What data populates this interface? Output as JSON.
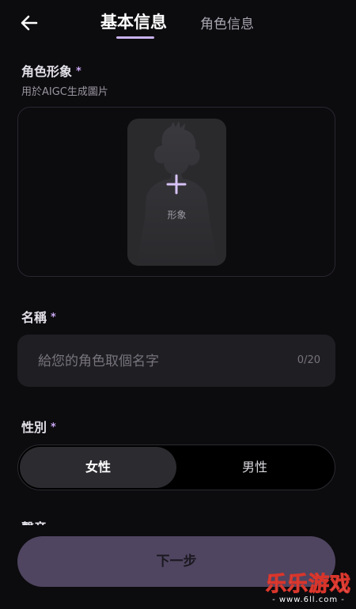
{
  "header": {
    "back_icon": "arrow-left-icon",
    "tabs": [
      {
        "label": "基本信息",
        "active": true
      },
      {
        "label": "角色信息",
        "active": false
      }
    ],
    "accent_color": "#c9b2ee"
  },
  "avatar_section": {
    "label": "角色形象",
    "required_mark": "*",
    "subtitle": "用於AIGC生成圖片",
    "card_icon": "plus-icon",
    "card_label": "形象"
  },
  "name_section": {
    "label": "名稱",
    "required_mark": "*",
    "placeholder": "給您的角色取個名字",
    "value": "",
    "counter": "0/20"
  },
  "gender_section": {
    "label": "性別",
    "required_mark": "*",
    "options": [
      {
        "label": "女性",
        "selected": true
      },
      {
        "label": "男性",
        "selected": false
      }
    ]
  },
  "next_section_partial": "聲音",
  "footer": {
    "next_label": "下一步",
    "button_color": "#4f4560"
  },
  "watermark": {
    "title": "乐乐游戏",
    "url": "- www.6ll.com -"
  }
}
